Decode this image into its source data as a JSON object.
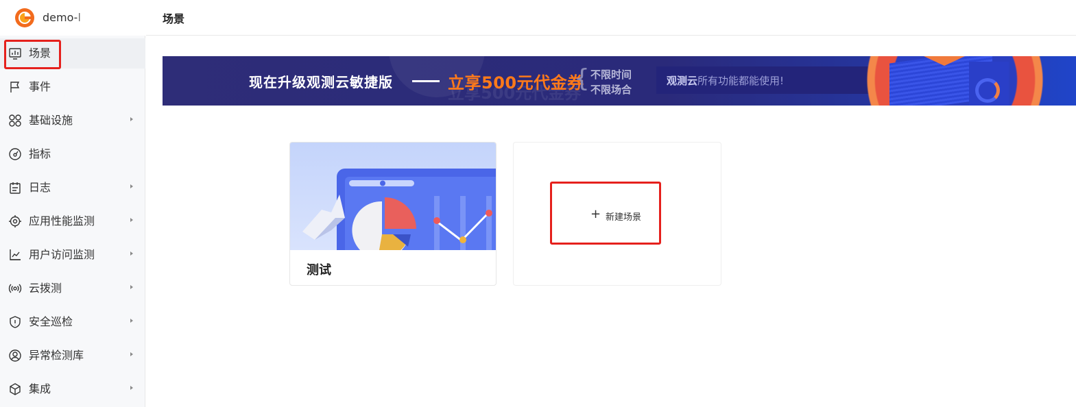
{
  "app": {
    "name": "demo-l"
  },
  "header": {
    "title": "场景"
  },
  "sidebar": {
    "items": [
      {
        "label": "场景",
        "icon": "monitor-chart-icon",
        "has_submenu": false,
        "active": true
      },
      {
        "label": "事件",
        "icon": "flag-icon",
        "has_submenu": false,
        "active": false
      },
      {
        "label": "基础设施",
        "icon": "grid-circles-icon",
        "has_submenu": true,
        "active": false
      },
      {
        "label": "指标",
        "icon": "gauge-icon",
        "has_submenu": false,
        "active": false
      },
      {
        "label": "日志",
        "icon": "calendar-log-icon",
        "has_submenu": true,
        "active": false
      },
      {
        "label": "应用性能监测",
        "icon": "target-icon",
        "has_submenu": true,
        "active": false
      },
      {
        "label": "用户访问监测",
        "icon": "user-chart-icon",
        "has_submenu": true,
        "active": false
      },
      {
        "label": "云拨测",
        "icon": "radio-wave-icon",
        "has_submenu": true,
        "active": false
      },
      {
        "label": "安全巡检",
        "icon": "shield-icon",
        "has_submenu": true,
        "active": false
      },
      {
        "label": "异常检测库",
        "icon": "anomaly-icon",
        "has_submenu": true,
        "active": false
      },
      {
        "label": "集成",
        "icon": "cube-icon",
        "has_submenu": true,
        "active": false
      }
    ]
  },
  "banner": {
    "main": "现在升级观测云敏捷版",
    "promo": "立享500元代金券",
    "line1": "不限时间",
    "line2": "不限场合",
    "pill_brand": "观测云",
    "pill_rest": "所有功能都能使用!"
  },
  "cards": {
    "scene_name": "测试",
    "new_label": "新建场景"
  },
  "colors": {
    "accent_red": "#e5201c",
    "banner_bg": "#2e2d78",
    "promo_orange": "#ff7a1a"
  }
}
